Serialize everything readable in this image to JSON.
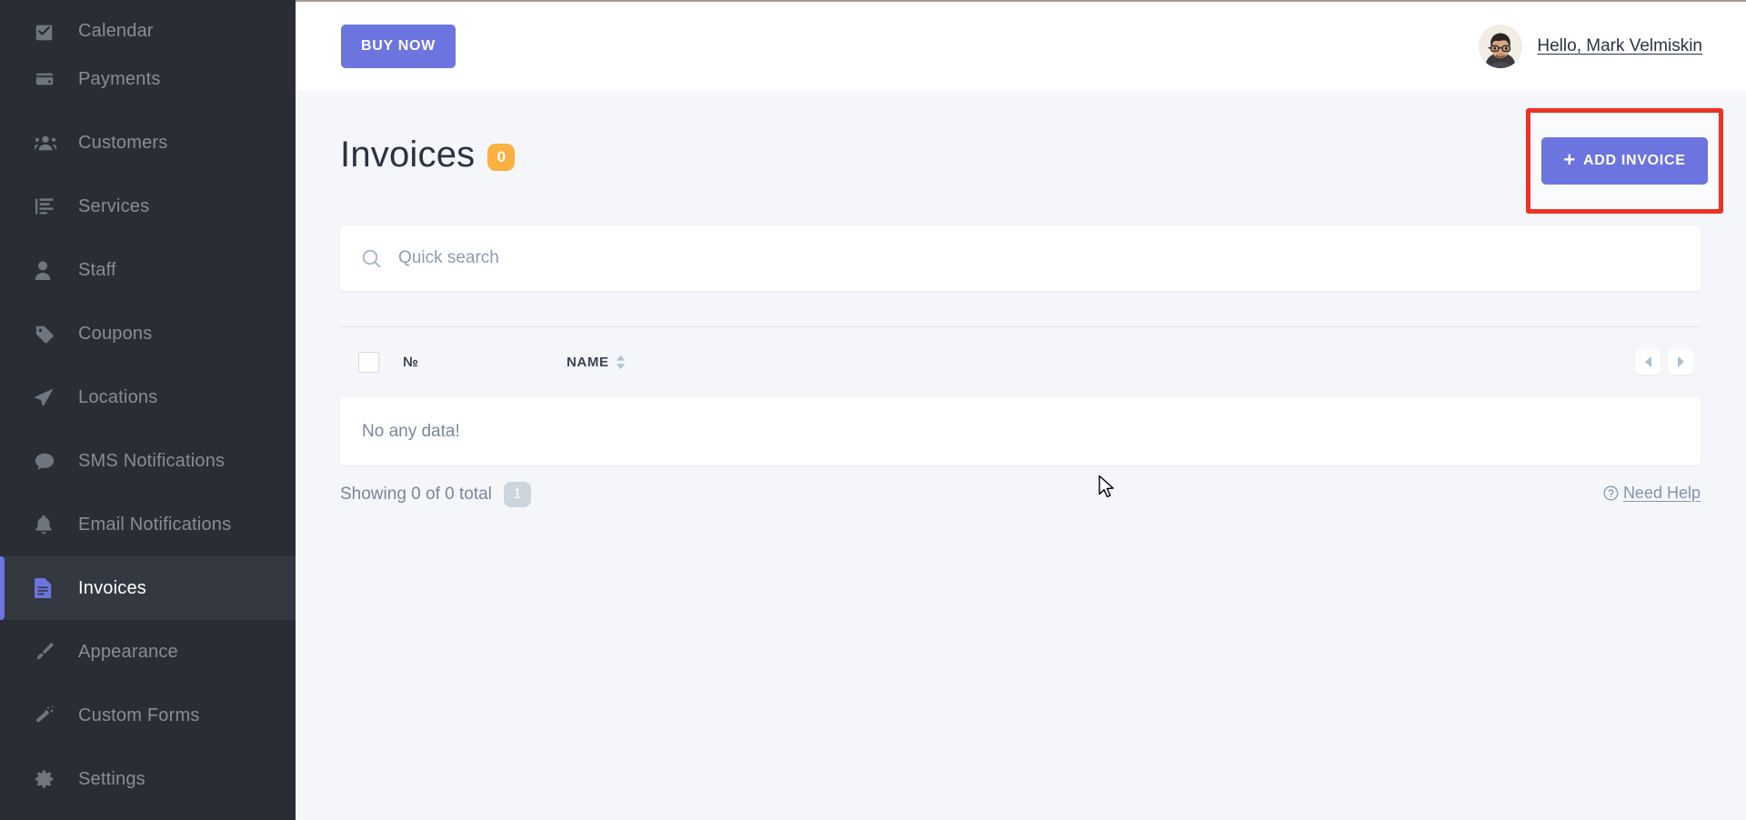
{
  "sidebar": {
    "items": [
      {
        "label": "Calendar",
        "icon": "calendar-check-icon",
        "active": false,
        "cut_off": true
      },
      {
        "label": "Payments",
        "icon": "wallet-icon",
        "active": false
      },
      {
        "label": "Customers",
        "icon": "users-icon",
        "active": false
      },
      {
        "label": "Services",
        "icon": "list-icon",
        "active": false
      },
      {
        "label": "Staff",
        "icon": "person-icon",
        "active": false
      },
      {
        "label": "Coupons",
        "icon": "tag-icon",
        "active": false
      },
      {
        "label": "Locations",
        "icon": "paper-plane-icon",
        "active": false
      },
      {
        "label": "SMS Notifications",
        "icon": "chat-bubble-icon",
        "active": false
      },
      {
        "label": "Email Notifications",
        "icon": "bell-icon",
        "active": false
      },
      {
        "label": "Invoices",
        "icon": "document-icon",
        "active": true
      },
      {
        "label": "Appearance",
        "icon": "paint-brush-icon",
        "active": false
      },
      {
        "label": "Custom Forms",
        "icon": "magic-wand-icon",
        "active": false
      },
      {
        "label": "Settings",
        "icon": "gear-icon",
        "active": false
      }
    ]
  },
  "header": {
    "buy_now_label": "BUY NOW",
    "greeting": "Hello, Mark Velmiskin"
  },
  "page": {
    "title": "Invoices",
    "count_badge": "0",
    "add_invoice_label": "ADD INVOICE",
    "add_invoice_plus": "+"
  },
  "search": {
    "placeholder": "Quick search",
    "value": ""
  },
  "table": {
    "columns": [
      "№",
      "NAME"
    ],
    "col_num": "№",
    "col_name": "NAME",
    "rows": [],
    "empty_message": "No any data!"
  },
  "footer": {
    "showing_text": "Showing 0 of 0 total",
    "page_badge": "1",
    "need_help_label": "Need Help"
  },
  "colors": {
    "accent": "#6c74e0",
    "sidebar_bg": "#2a2e34",
    "sidebar_active_bg": "#343840",
    "badge_orange": "#fbb040",
    "highlight_red": "#ee3124",
    "canvas": "#f4f6fa"
  }
}
